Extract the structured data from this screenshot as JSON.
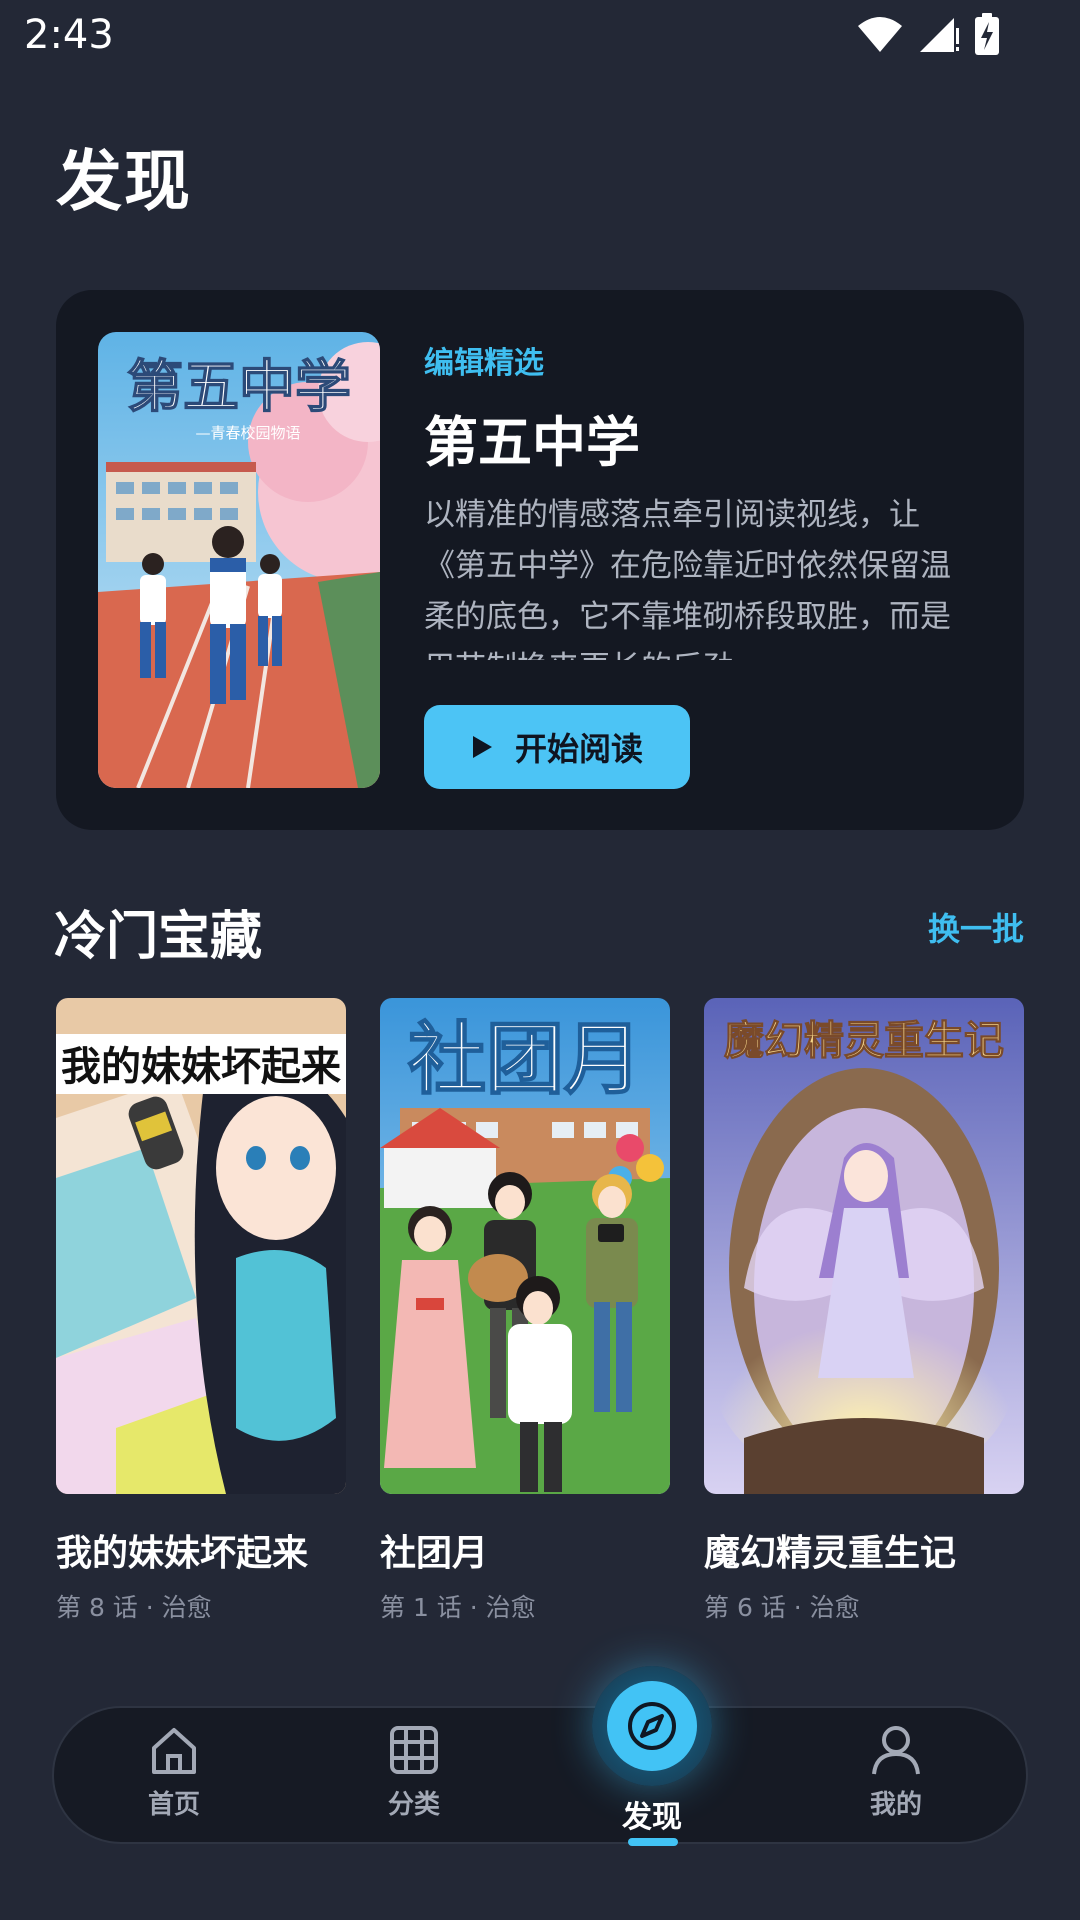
{
  "status_bar": {
    "time": "2:43"
  },
  "page": {
    "title": "发现"
  },
  "featured": {
    "tag": "编辑精选",
    "title": "第五中学",
    "description": "以精准的情感落点牵引阅读视线，让《第五中学》在危险靠近时依然保留温柔的底色，它不靠堆砌桥段取胜，而是用节制换来更长的后劲。",
    "read_button": "开始阅读",
    "cover": {
      "title": "第五中学",
      "subtitle": "—青春校园物语"
    }
  },
  "section": {
    "title": "冷门宝藏",
    "refresh_label": "换一批"
  },
  "books": [
    {
      "title": "我的妹妹坏起来",
      "meta": "第 8 话 · 治愈",
      "cover_text": "我的妹妹坏起来"
    },
    {
      "title": "社团月",
      "meta": "第 1 话 · 治愈",
      "cover_text": "社团月"
    },
    {
      "title": "魔幻精灵重生记",
      "meta": "第 6 话 · 治愈",
      "cover_text": "魔幻精灵重生记"
    }
  ],
  "nav": {
    "home": "首页",
    "category": "分类",
    "discover": "发现",
    "mine": "我的"
  },
  "colors": {
    "background": "#232836",
    "card": "#141822",
    "accent": "#42c3f5"
  },
  "icons": [
    "wifi-icon",
    "signal-icon",
    "battery-icon",
    "play-icon",
    "home-icon",
    "grid-icon",
    "compass-icon",
    "user-icon"
  ]
}
